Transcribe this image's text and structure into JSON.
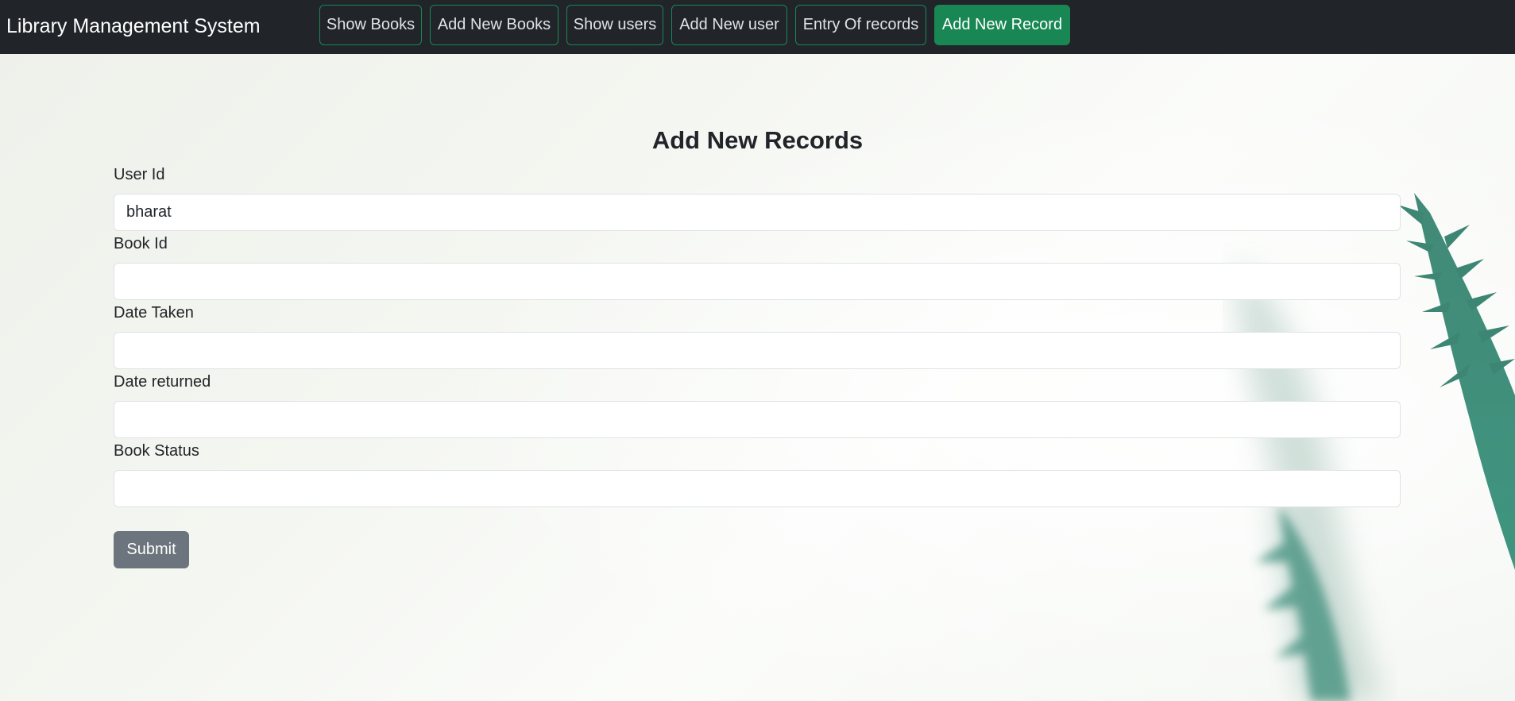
{
  "app": {
    "brand": "Library Management System"
  },
  "nav": {
    "buttons": [
      {
        "label": "Show Books"
      },
      {
        "label": "Add New Books"
      },
      {
        "label": "Show users"
      },
      {
        "label": "Add New user"
      },
      {
        "label": "Entry Of records"
      },
      {
        "label": "Add New Record"
      }
    ],
    "active_index": 5
  },
  "form": {
    "title": "Add New Records",
    "fields": [
      {
        "label": "User Id",
        "value": ""
      },
      {
        "label": "Book Id",
        "value": ""
      },
      {
        "label": "Date Taken",
        "value": ""
      },
      {
        "label": "Date returned",
        "value": ""
      },
      {
        "label": "Book Status",
        "value": ""
      }
    ],
    "user_id_value": "bharat",
    "submit_label": "Submit"
  },
  "colors": {
    "navbar_bg": "#212529",
    "accent": "#198754",
    "submit_bg": "#6c757d"
  }
}
